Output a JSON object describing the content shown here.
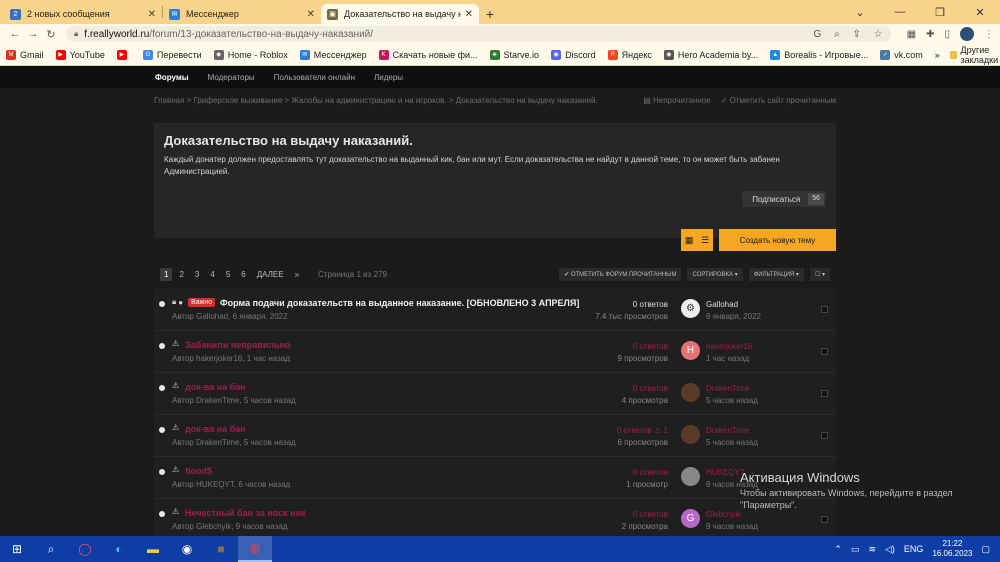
{
  "tabs": [
    {
      "label": "2 новых сообщения",
      "icon": "2",
      "icon_color": "#3b6fc4",
      "active": false
    },
    {
      "label": "Мессенджер",
      "icon": "✉",
      "icon_color": "#2a7de1",
      "active": false
    },
    {
      "label": "Доказательство на выдачу нака",
      "icon": "▣",
      "icon_color": "#7a6a3b",
      "active": true
    }
  ],
  "address": {
    "domain": "f.reallyworld.ru",
    "path": "/forum/13-доказательство-на-выдачу-наказаний/"
  },
  "bookmarks": [
    {
      "label": "Gmail",
      "icon": "M",
      "color": "#d93025"
    },
    {
      "label": "YouTube",
      "icon": "▶",
      "color": "#ff0000"
    },
    {
      "label": "",
      "icon": "▶",
      "color": "#ff0000"
    },
    {
      "label": "Перевести",
      "icon": "G",
      "color": "#4285f4"
    },
    {
      "label": "Home - Roblox",
      "icon": "◆",
      "color": "#666666"
    },
    {
      "label": "Мессенджер",
      "icon": "✉",
      "color": "#2a7de1"
    },
    {
      "label": "Скачать новые фи...",
      "icon": "K",
      "color": "#c2185b"
    },
    {
      "label": "Starve.io",
      "icon": "♣",
      "color": "#2e7d32"
    },
    {
      "label": "Discord",
      "icon": "◉",
      "color": "#5865f2"
    },
    {
      "label": "Яндекс",
      "icon": "Я",
      "color": "#fc3f1d"
    },
    {
      "label": "Hero Academia by...",
      "icon": "◉",
      "color": "#555555"
    },
    {
      "label": "Borealis - Игровые...",
      "icon": "▲",
      "color": "#1e88e5"
    },
    {
      "label": "vk.com",
      "icon": "✓",
      "color": "#4a76a8"
    }
  ],
  "bookmarks_more": "»",
  "other_bookmarks": "Другие закладки",
  "topnav": [
    "Форумы",
    "Модераторы",
    "Пользователи онлайн",
    "Лидеры"
  ],
  "breadcrumb": "Главная > Гриферское выживание > Жалобы на администрацию и на игроков. > Доказательство на выдачу наказаний.",
  "crumb_actions": {
    "unread": "Непрочитанное",
    "mark_read": "Отметить сайт прочитанным"
  },
  "forum": {
    "title": "Доказательство на выдачу наказаний.",
    "description": "Каждый донатер должен предоставлять тут доказательство на выданный кик, бан или мут. Если доказательства не найдут в данной теме, то он может быть забанен Администрацией.",
    "subscribe_label": "Подписаться",
    "subscribe_count": "56"
  },
  "create_topic": "Создать новую тему",
  "pager": {
    "pages": [
      "1",
      "2",
      "3",
      "4",
      "5",
      "6"
    ],
    "next": "ДАЛЕЕ",
    "last": "»",
    "info": "Страница 1 из 279"
  },
  "filters": {
    "mark_read": "✔ ОТМЕТИТЬ ФОРУМ ПРОЧИТАННЫМ",
    "sort": "СОРТИРОВКА ▾",
    "filter": "ФИЛЬТРАЦИЯ ▾",
    "select": "☐ ▾"
  },
  "topics": [
    {
      "title": "Форма подачи доказательств на выданное наказание. [ОБНОВЛЕНО 3 АПРЕЛЯ]",
      "badge": "Важно",
      "pinned": true,
      "meta": "Автор Gallohad, 6 января, 2022",
      "answers": "0 ответов",
      "views": "7.4 тыс просмотров",
      "last_user": "Gallohad",
      "last_time": "6 января, 2022",
      "avatar_letter": "⚙",
      "avatar_color": "#eeeeee"
    },
    {
      "title": "Забанили неправильно",
      "badge": "",
      "pinned": false,
      "meta": "Автор hakerjoker16, 1 час назад",
      "answers": "0 ответов",
      "views": "9 просмотров",
      "last_user": "hakerjoker16",
      "last_time": "1 час назад",
      "avatar_letter": "H",
      "avatar_color": "#e57373"
    },
    {
      "title": "док-ва на бан",
      "badge": "",
      "pinned": false,
      "meta": "Автор DrakenTime, 5 часов назад",
      "answers": "0 ответов",
      "views": "4 просмотра",
      "last_user": "DrakenTime",
      "last_time": "5 часов назад",
      "avatar_letter": "",
      "avatar_color": "#5a3a2a"
    },
    {
      "title": "док-ва на бан",
      "badge": "",
      "pinned": false,
      "meta": "Автор DrakenTime, 5 часов назад",
      "answers": "0 ответов ⚠ 1",
      "views": "6 просмотров",
      "last_user": "DrakenTime",
      "last_time": "5 часов назад",
      "avatar_letter": "",
      "avatar_color": "#5a3a2a"
    },
    {
      "title": "flood$",
      "badge": "",
      "pinned": false,
      "meta": "Автор HUKEQYT, 6 часов назад",
      "answers": "0 ответов",
      "views": "1 просмотр",
      "last_user": "HUKEQYT",
      "last_time": "6 часов назад",
      "avatar_letter": "",
      "avatar_color": "#888888"
    },
    {
      "title": "Нечестный бан за носк ник",
      "badge": "",
      "pinned": false,
      "meta": "Автор Glebchyik, 9 часов назад",
      "answers": "0 ответов",
      "views": "2 просмотра",
      "last_user": "Glebchyik",
      "last_time": "9 часов назад",
      "avatar_letter": "G",
      "avatar_color": "#ba68c8"
    }
  ],
  "watermark": {
    "line1": "Активация Windows",
    "line2": "Чтобы активировать Windows, перейдите в раздел \"Параметры\"."
  },
  "taskbar": {
    "lang": "ENG",
    "time": "21:22",
    "date": "16.06.2023"
  }
}
